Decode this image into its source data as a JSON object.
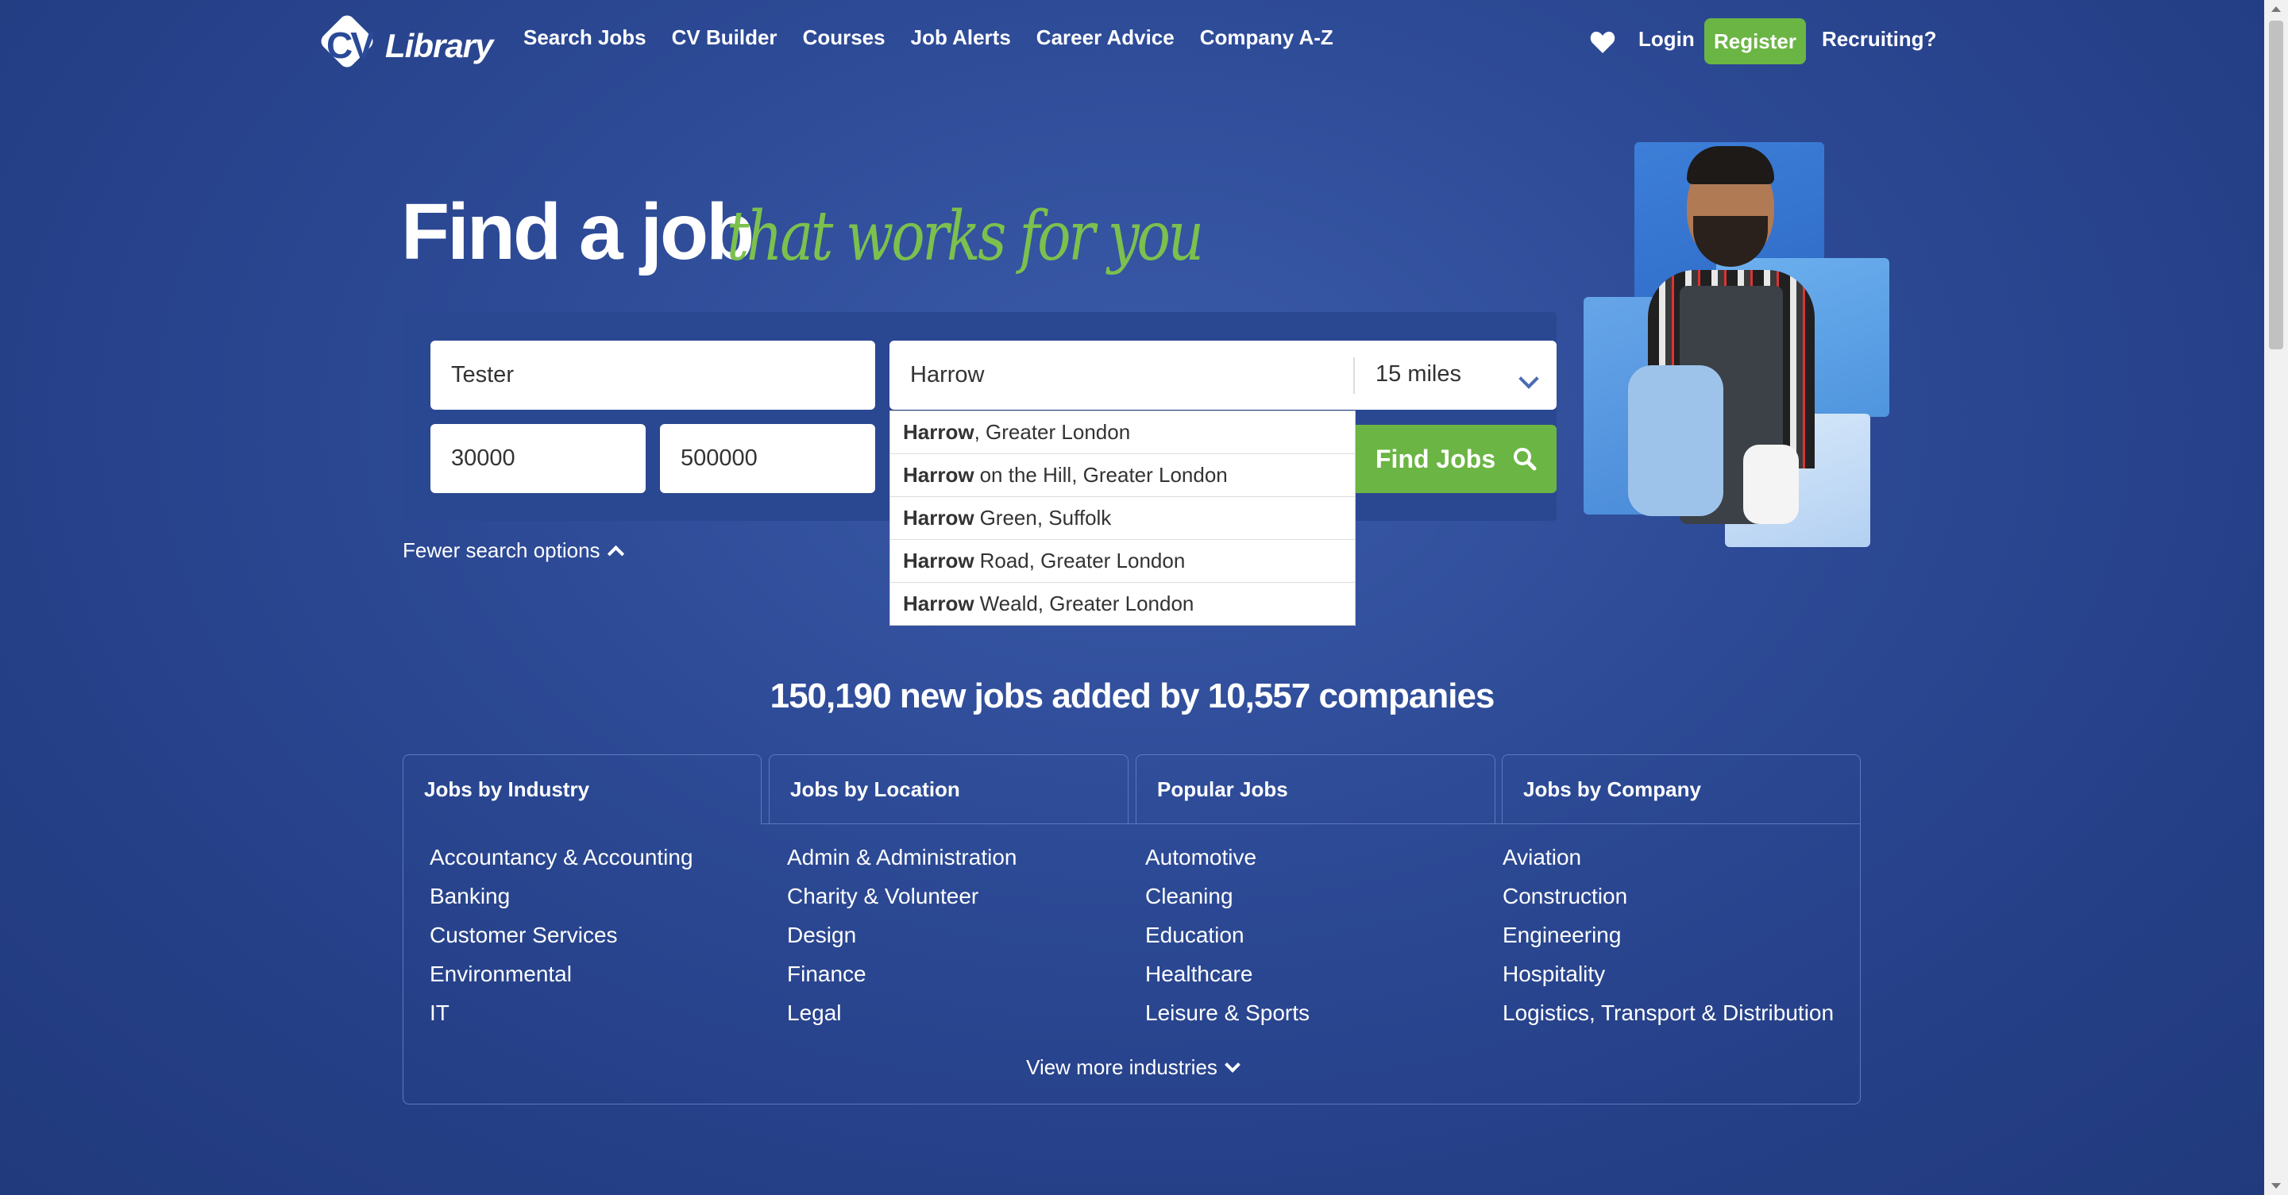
{
  "header": {
    "logo_text": "Library",
    "logo_mark": "CV",
    "nav": [
      "Search Jobs",
      "CV Builder",
      "Courses",
      "Job Alerts",
      "Career Advice",
      "Company A-Z"
    ],
    "login": "Login",
    "register": "Register",
    "recruiting": "Recruiting?"
  },
  "hero": {
    "title": "Find a job",
    "tagline": "that works for you"
  },
  "search": {
    "keywords_value": "Tester",
    "location_value": "Harrow",
    "distance_value": "15 miles",
    "salary_min_value": "30000",
    "salary_max_value": "500000",
    "find_label": "Find Jobs",
    "fewer_options": "Fewer search options",
    "suggestions": [
      {
        "bold": "Harrow",
        "rest": ", Greater London"
      },
      {
        "bold": "Harrow",
        "rest": "on the Hill, Greater London"
      },
      {
        "bold": "Harrow",
        "rest": "Green, Suffolk"
      },
      {
        "bold": "Harrow",
        "rest": "Road, Greater London"
      },
      {
        "bold": "Harrow",
        "rest": "Weald, Greater London"
      }
    ]
  },
  "stats": "150,190 new jobs added by 10,557 companies",
  "tabs": [
    "Jobs by Industry",
    "Jobs by Location",
    "Popular Jobs",
    "Jobs by Company"
  ],
  "industries": {
    "col1": [
      "Accountancy & Accounting",
      "Banking",
      "Customer Services",
      "Environmental",
      "IT"
    ],
    "col2": [
      "Admin & Administration",
      "Charity & Volunteer",
      "Design",
      "Finance",
      "Legal"
    ],
    "col3": [
      "Automotive",
      "Cleaning",
      "Education",
      "Healthcare",
      "Leisure & Sports"
    ],
    "col4": [
      "Aviation",
      "Construction",
      "Engineering",
      "Hospitality",
      "Logistics, Transport & Distribution"
    ]
  },
  "view_more": "View more industries",
  "colors": {
    "accent_green": "#6bb544",
    "tag_green": "#7cc04e",
    "bg_blue": "#2d4a96"
  },
  "icons": [
    "heart-icon",
    "search-icon",
    "chevron-down-icon",
    "chevron-up-icon"
  ]
}
